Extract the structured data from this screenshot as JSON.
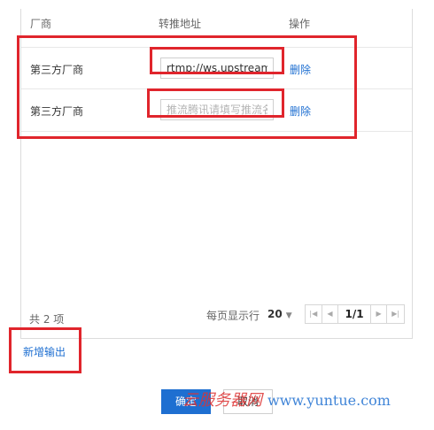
{
  "table": {
    "headers": {
      "vendor": "厂商",
      "address": "转推地址",
      "action": "操作"
    },
    "rows": [
      {
        "vendor": "第三方厂商",
        "address_value": "rtmp://ws.upstream.hu",
        "address_placeholder": "",
        "delete_label": "删除"
      },
      {
        "vendor": "第三方厂商",
        "address_value": "",
        "address_placeholder": "推流腾讯请填写推流名",
        "delete_label": "删除"
      }
    ]
  },
  "footer": {
    "total": "共 2 项",
    "per_page_label": "每页显示行",
    "page_size": "20",
    "page_indicator": "1/1"
  },
  "add_output_label": "新增输出",
  "buttons": {
    "ok": "确定",
    "cancel": "取消"
  },
  "watermark": {
    "brand": "云服务器网",
    "site": "www.yuntue.com"
  },
  "colors": {
    "accent": "#1e6fd1",
    "highlight": "#e0252c"
  }
}
